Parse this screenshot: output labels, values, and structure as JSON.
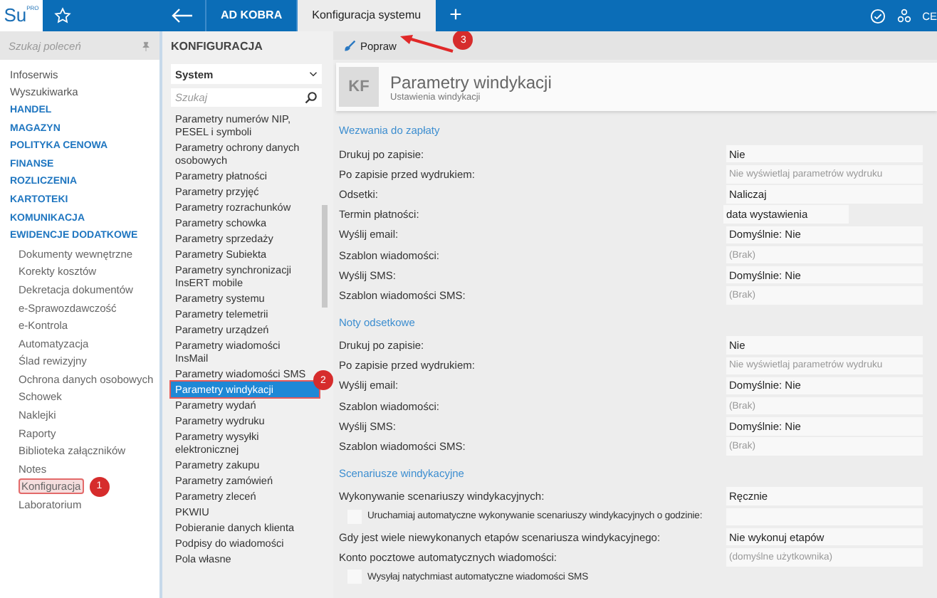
{
  "topbar": {
    "logo": "Su",
    "logo_sup": "PRO",
    "tabs": [
      {
        "label": "AD KOBRA",
        "selected": false
      },
      {
        "label": "Konfiguracja systemu",
        "selected": true
      }
    ],
    "plus": "+",
    "user": "CE"
  },
  "sidebar": {
    "search": {
      "placeholder": "Szukaj poleceń"
    },
    "items": [
      {
        "label": "Infoserwis",
        "kind": "plain",
        "selected": false
      },
      {
        "label": "Wyszukiwarka",
        "kind": "plain",
        "selected": false
      },
      {
        "label": "HANDEL",
        "kind": "section",
        "selected": false
      },
      {
        "label": "MAGAZYN",
        "kind": "section",
        "selected": false
      },
      {
        "label": "POLITYKA CENOWA",
        "kind": "section",
        "selected": false
      },
      {
        "label": "FINANSE",
        "kind": "section",
        "selected": false
      },
      {
        "label": "ROZLICZENIA",
        "kind": "section",
        "selected": false
      },
      {
        "label": "KARTOTEKI",
        "kind": "section",
        "selected": false
      },
      {
        "label": "KOMUNIKACJA",
        "kind": "section",
        "selected": false
      },
      {
        "label": "EWIDENCJE DODATKOWE",
        "kind": "section",
        "selected": false
      },
      {
        "label": "Dokumenty wewnętrzne",
        "kind": "sub",
        "selected": false
      },
      {
        "label": "Korekty kosztów",
        "kind": "sub",
        "selected": false
      },
      {
        "label": "Dekretacja dokumentów",
        "kind": "sub",
        "selected": false
      },
      {
        "label": "e-Sprawozdawczość",
        "kind": "sub",
        "selected": false
      },
      {
        "label": "e-Kontrola",
        "kind": "sub",
        "selected": false
      },
      {
        "label": "Automatyzacja",
        "kind": "sub",
        "selected": false
      },
      {
        "label": "Ślad rewizyjny",
        "kind": "sub",
        "selected": false
      },
      {
        "label": "Ochrona danych osobowych",
        "kind": "sub",
        "selected": false
      },
      {
        "label": "Schowek",
        "kind": "sub",
        "selected": false
      },
      {
        "label": "Naklejki",
        "kind": "sub",
        "selected": false
      },
      {
        "label": "Raporty",
        "kind": "sub",
        "selected": false
      },
      {
        "label": "Biblioteka załączników",
        "kind": "sub",
        "selected": false
      },
      {
        "label": "Notes",
        "kind": "sub",
        "selected": false
      },
      {
        "label": "Konfiguracja",
        "kind": "sub",
        "selected": true,
        "badge": "1"
      },
      {
        "label": "Laboratorium",
        "kind": "sub",
        "selected": false
      }
    ]
  },
  "config": {
    "title": "KONFIGURACJA",
    "dropdown": "System",
    "search": {
      "placeholder": "Szukaj"
    },
    "items": [
      {
        "label": "Parametry numerów NIP, PESEL i symboli",
        "selected": false
      },
      {
        "label": "Parametry ochrony danych osobowych",
        "selected": false
      },
      {
        "label": "Parametry płatności",
        "selected": false
      },
      {
        "label": "Parametry przyjęć",
        "selected": false
      },
      {
        "label": "Parametry rozrachunków",
        "selected": false
      },
      {
        "label": "Parametry schowka",
        "selected": false
      },
      {
        "label": "Parametry sprzedaży",
        "selected": false
      },
      {
        "label": "Parametry Subiekta",
        "selected": false
      },
      {
        "label": "Parametry synchronizacji InsERT mobile",
        "selected": false
      },
      {
        "label": "Parametry systemu",
        "selected": false
      },
      {
        "label": "Parametry telemetrii",
        "selected": false
      },
      {
        "label": "Parametry urządzeń",
        "selected": false
      },
      {
        "label": "Parametry wiadomości InsMail",
        "selected": false
      },
      {
        "label": "Parametry wiadomości SMS",
        "selected": false
      },
      {
        "label": "Parametry windykacji",
        "selected": true,
        "badge": "2"
      },
      {
        "label": "Parametry wydań",
        "selected": false
      },
      {
        "label": "Parametry wydruku",
        "selected": false
      },
      {
        "label": "Parametry wysyłki elektronicznej",
        "selected": false
      },
      {
        "label": "Parametry zakupu",
        "selected": false
      },
      {
        "label": "Parametry zamówień",
        "selected": false
      },
      {
        "label": "Parametry zleceń",
        "selected": false
      },
      {
        "label": "PKWIU",
        "selected": false
      },
      {
        "label": "Pobieranie danych klienta",
        "selected": false
      },
      {
        "label": "Podpisy do wiadomości",
        "selected": false
      },
      {
        "label": "Pola własne",
        "selected": false
      }
    ]
  },
  "toolbar": {
    "edit_button": "Popraw",
    "badge": "3"
  },
  "header": {
    "initials": "KF",
    "title": "Parametry windykacji",
    "subtitle": "Ustawienia windykacji"
  },
  "sections": [
    {
      "title": "Wezwania do zapłaty",
      "rows": [
        {
          "kind": "field",
          "label": "Drukuj po zapisie:",
          "value": "Nie",
          "short": false
        },
        {
          "kind": "field",
          "label": "Po zapisie przed wydrukiem:",
          "placeholder": "Nie wyświetlaj parametrów wydruku",
          "short": false
        },
        {
          "kind": "field",
          "label": "Odsetki:",
          "value": "Naliczaj",
          "short": false
        },
        {
          "kind": "field",
          "label": "Termin płatności:",
          "value": "data wystawienia",
          "short": true
        },
        {
          "kind": "field",
          "label": "Wyślij email:",
          "value": "Domyślnie:  Nie",
          "short": false
        },
        {
          "kind": "field",
          "label": "Szablon wiadomości:",
          "placeholder": "(Brak)",
          "short": false
        },
        {
          "kind": "field",
          "label": "Wyślij SMS:",
          "value": "Domyślnie:  Nie",
          "short": false
        },
        {
          "kind": "field",
          "label": "Szablon wiadomości SMS:",
          "placeholder": "(Brak)",
          "short": false
        }
      ]
    },
    {
      "title": "Noty odsetkowe",
      "rows": [
        {
          "kind": "field",
          "label": "Drukuj po zapisie:",
          "value": "Nie",
          "short": false
        },
        {
          "kind": "field",
          "label": "Po zapisie przed wydrukiem:",
          "placeholder": "Nie wyświetlaj parametrów wydruku",
          "short": false
        },
        {
          "kind": "field",
          "label": "Wyślij email:",
          "value": "Domyślnie:  Nie",
          "short": false
        },
        {
          "kind": "field",
          "label": "Szablon wiadomości:",
          "placeholder": "(Brak)",
          "short": false
        },
        {
          "kind": "field",
          "label": "Wyślij SMS:",
          "value": "Domyślnie:  Nie",
          "short": false
        },
        {
          "kind": "field",
          "label": "Szablon wiadomości SMS:",
          "placeholder": "(Brak)",
          "short": false
        }
      ]
    },
    {
      "title": "Scenariusze windykacyjne",
      "rows": [
        {
          "kind": "field",
          "label": "Wykonywanie scenariuszy windykacyjnych:",
          "value": "Ręcznie",
          "short": false
        },
        {
          "kind": "checkbox",
          "label": "Uruchamiaj automatyczne wykonywanie scenariuszy windykacyjnych o godzinie:",
          "checked": false,
          "has_field": true
        },
        {
          "kind": "field",
          "label": "Gdy jest wiele niewykonanych etapów scenariusza windykacyjnego:",
          "value": "Nie wykonuj etapów",
          "short": false
        },
        {
          "kind": "field",
          "label": "Konto pocztowe automatycznych wiadomości:",
          "placeholder": "(domyślne użytkownika)",
          "short": false
        },
        {
          "kind": "checkbox",
          "label": "Wysyłaj natychmiast automatyczne wiadomości SMS",
          "checked": false,
          "has_field": false
        }
      ]
    }
  ]
}
